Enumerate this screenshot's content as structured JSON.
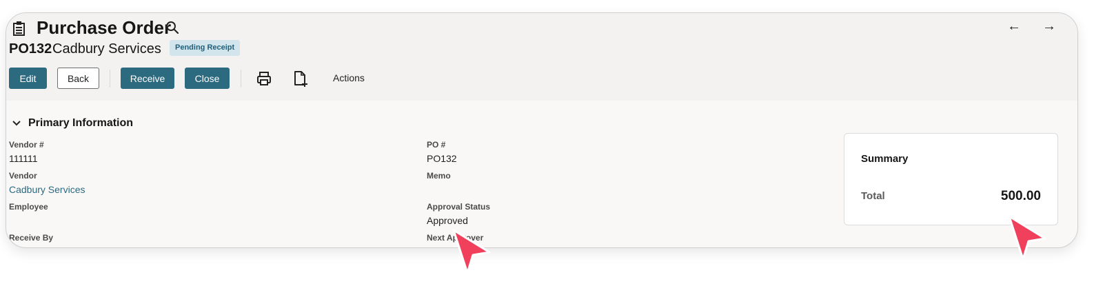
{
  "header": {
    "title": "Purchase Order",
    "record_number": "PO132",
    "record_name": "Cadbury Services",
    "status_badge": "Pending Receipt",
    "icons": {
      "record": "record-list-icon",
      "search": "search-icon",
      "back": "arrow-left-icon",
      "forward": "arrow-right-icon"
    }
  },
  "toolbar": {
    "edit_label": "Edit",
    "back_label": "Back",
    "receive_label": "Receive",
    "close_label": "Close",
    "print_icon": "printer-icon",
    "new_doc_icon": "new-document-icon",
    "actions_label": "Actions"
  },
  "section": {
    "title": "Primary Information",
    "chevron_icon": "chevron-down-icon"
  },
  "fields_left": [
    {
      "label": "Vendor #",
      "value": "111111"
    },
    {
      "label": "Vendor",
      "value": "Cadbury Services"
    },
    {
      "label": "Employee",
      "value": ""
    },
    {
      "label": "Receive By",
      "value": ""
    }
  ],
  "fields_right": [
    {
      "label": "PO #",
      "value": "PO132"
    },
    {
      "label": "Memo",
      "value": ""
    },
    {
      "label": "Approval Status",
      "value": "Approved"
    },
    {
      "label": "Next Approver",
      "value": ""
    }
  ],
  "summary": {
    "title": "Summary",
    "total_label": "Total",
    "total_value": "500.00"
  },
  "colors": {
    "accent": "#2c6a80",
    "badge_bg": "#d3e5ec",
    "cursor": "#f0405b"
  }
}
